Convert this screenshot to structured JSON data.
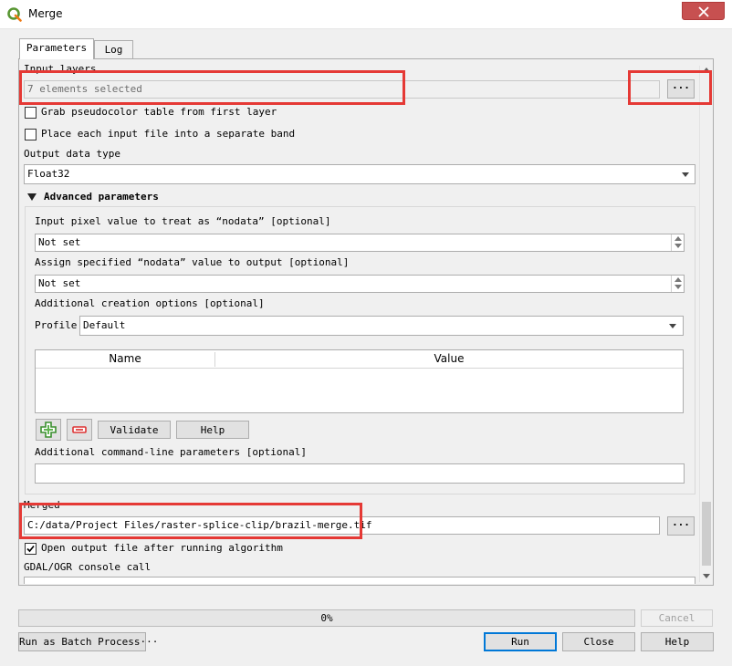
{
  "window": {
    "title": "Merge"
  },
  "tabs": [
    {
      "label": "Parameters"
    },
    {
      "label": "Log"
    }
  ],
  "input_layers": {
    "label": "Input layers",
    "value": "7 elements selected",
    "browse_label": "···"
  },
  "options": {
    "grab_pseudocolor": {
      "label": "Grab pseudocolor table from first layer",
      "checked": false
    },
    "separate_band": {
      "label": "Place each input file into a separate band",
      "checked": false
    }
  },
  "output_type": {
    "label": "Output data type",
    "value": "Float32"
  },
  "advanced": {
    "title": "Advanced parameters",
    "nodata_input": {
      "label": "Input pixel value to treat as “nodata” [optional]",
      "value": "Not set"
    },
    "nodata_output": {
      "label": "Assign specified “nodata” value to output [optional]",
      "value": "Not set"
    },
    "creation_options": {
      "label": "Additional creation options [optional]",
      "profile_label": "Profile",
      "profile_value": "Default",
      "columns": [
        "Name",
        "Value"
      ],
      "validate_label": "Validate",
      "help_label": "Help"
    },
    "extra_params": {
      "label": "Additional command-line parameters [optional]",
      "value": ""
    }
  },
  "merged": {
    "label": "Merged",
    "value": "C:/data/Project Files/raster-splice-clip/brazil-merge.tif",
    "browse_label": "···"
  },
  "open_output": {
    "label": "Open output file after running algorithm",
    "checked": true
  },
  "console": {
    "label": "GDAL/OGR console call"
  },
  "progress": {
    "text": "0%",
    "value": 0
  },
  "buttons": {
    "cancel": "Cancel",
    "batch": "Run as Batch Process···",
    "run": "Run",
    "close": "Close",
    "help": "Help"
  },
  "colors": {
    "highlight": "#e53935",
    "accent": "#0078d7",
    "close_button": "#c75050"
  }
}
